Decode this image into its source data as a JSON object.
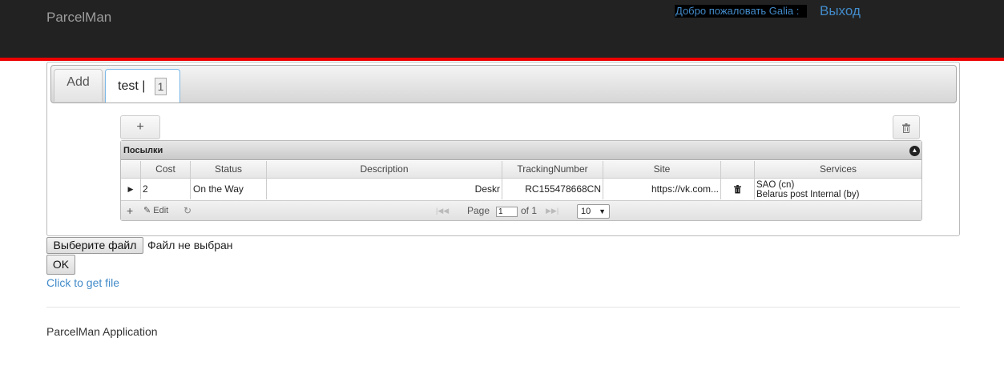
{
  "navbar": {
    "brand": "ParcelMan",
    "welcome": "Добро пожаловать Galia :",
    "logout": "Выход"
  },
  "tabs": [
    {
      "label": "Add"
    },
    {
      "label": "test |",
      "badge": "1"
    }
  ],
  "toolbar": {
    "add_symbol": "+",
    "delete_icon": "trash-icon"
  },
  "grid": {
    "caption": "Посылки",
    "columns": [
      "Cost",
      "Status",
      "Description",
      "TrackingNumber",
      "Site",
      "Services"
    ],
    "rows": [
      {
        "cost": "2",
        "status": "On the Way",
        "description": "Deskr",
        "tracking": "RC155478668CN",
        "site": "https://vk.com...",
        "services_line1": "SAO (cn)",
        "services_line2": "Belarus post Internal (by)"
      }
    ],
    "pager": {
      "add_symbol": "+",
      "edit_label": "Edit",
      "page_label": "Page",
      "page_value": "1",
      "of_label": "of 1",
      "rows_per_page": "10"
    }
  },
  "upload": {
    "choose_button": "Выберите файл",
    "status": "Файл не выбран",
    "ok_button": "OK",
    "get_file_link": "Click to get file"
  },
  "footer": {
    "text": "ParcelMan Application"
  }
}
